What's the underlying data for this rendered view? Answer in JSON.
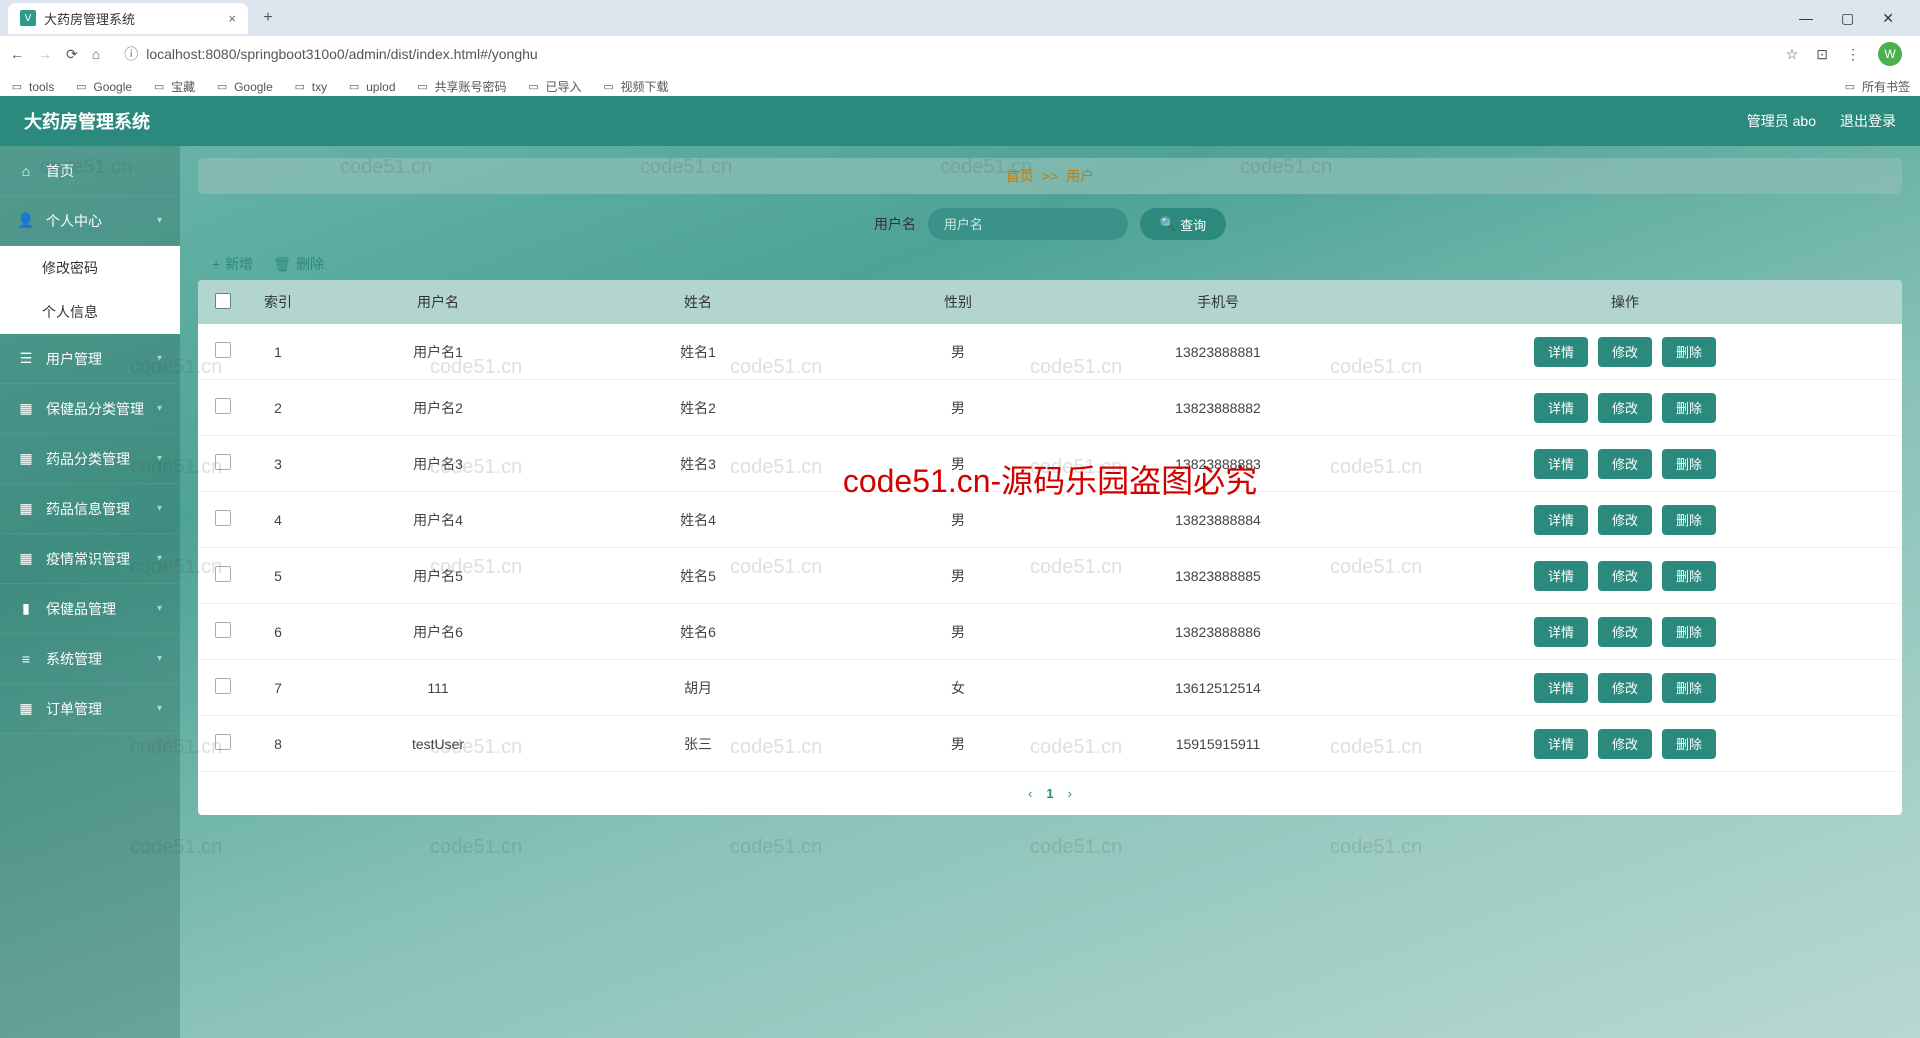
{
  "browser": {
    "tab_title": "大药房管理系统",
    "url": "localhost:8080/springboot310o0/admin/dist/index.html#/yonghu",
    "bookmarks": [
      "tools",
      "Google",
      "宝藏",
      "Google",
      "txy",
      "uplod",
      "共享账号密码",
      "已导入",
      "视频下载"
    ],
    "all_bookmarks": "所有书签",
    "avatar_letter": "W"
  },
  "header": {
    "title": "大药房管理系统",
    "admin": "管理员 abo",
    "logout": "退出登录"
  },
  "sidebar": {
    "items": [
      {
        "icon": "home",
        "label": "首页",
        "expandable": false
      },
      {
        "icon": "user",
        "label": "个人中心",
        "expandable": true,
        "expanded": true,
        "children": [
          "修改密码",
          "个人信息"
        ]
      },
      {
        "icon": "list",
        "label": "用户管理",
        "expandable": true
      },
      {
        "icon": "grid",
        "label": "保健品分类管理",
        "expandable": true
      },
      {
        "icon": "grid",
        "label": "药品分类管理",
        "expandable": true
      },
      {
        "icon": "grid",
        "label": "药品信息管理",
        "expandable": true
      },
      {
        "icon": "grid",
        "label": "疫情常识管理",
        "expandable": true
      },
      {
        "icon": "bar",
        "label": "保健品管理",
        "expandable": true
      },
      {
        "icon": "stack",
        "label": "系统管理",
        "expandable": true
      },
      {
        "icon": "grid",
        "label": "订单管理",
        "expandable": true
      }
    ]
  },
  "breadcrumb": {
    "home": "首页",
    "sep": ">>",
    "current": "用户"
  },
  "search": {
    "label": "用户名",
    "placeholder": "用户名",
    "button": "查询"
  },
  "toolbar": {
    "add": "新增",
    "delete": "删除"
  },
  "table": {
    "headers": {
      "index": "索引",
      "username": "用户名",
      "name": "姓名",
      "gender": "性别",
      "phone": "手机号",
      "ops": "操作"
    },
    "ops": {
      "detail": "详情",
      "edit": "修改",
      "delete": "删除"
    },
    "rows": [
      {
        "idx": "1",
        "username": "用户名1",
        "name": "姓名1",
        "gender": "男",
        "phone": "13823888881"
      },
      {
        "idx": "2",
        "username": "用户名2",
        "name": "姓名2",
        "gender": "男",
        "phone": "13823888882"
      },
      {
        "idx": "3",
        "username": "用户名3",
        "name": "姓名3",
        "gender": "男",
        "phone": "13823888883"
      },
      {
        "idx": "4",
        "username": "用户名4",
        "name": "姓名4",
        "gender": "男",
        "phone": "13823888884"
      },
      {
        "idx": "5",
        "username": "用户名5",
        "name": "姓名5",
        "gender": "男",
        "phone": "13823888885"
      },
      {
        "idx": "6",
        "username": "用户名6",
        "name": "姓名6",
        "gender": "男",
        "phone": "13823888886"
      },
      {
        "idx": "7",
        "username": "111",
        "name": "胡月",
        "gender": "女",
        "phone": "13612512514"
      },
      {
        "idx": "8",
        "username": "testUser",
        "name": "张三",
        "gender": "男",
        "phone": "15915915911"
      }
    ]
  },
  "pager": {
    "current": "1"
  },
  "overlay": "code51.cn-源码乐园盗图必究",
  "watermark": "code51.cn"
}
